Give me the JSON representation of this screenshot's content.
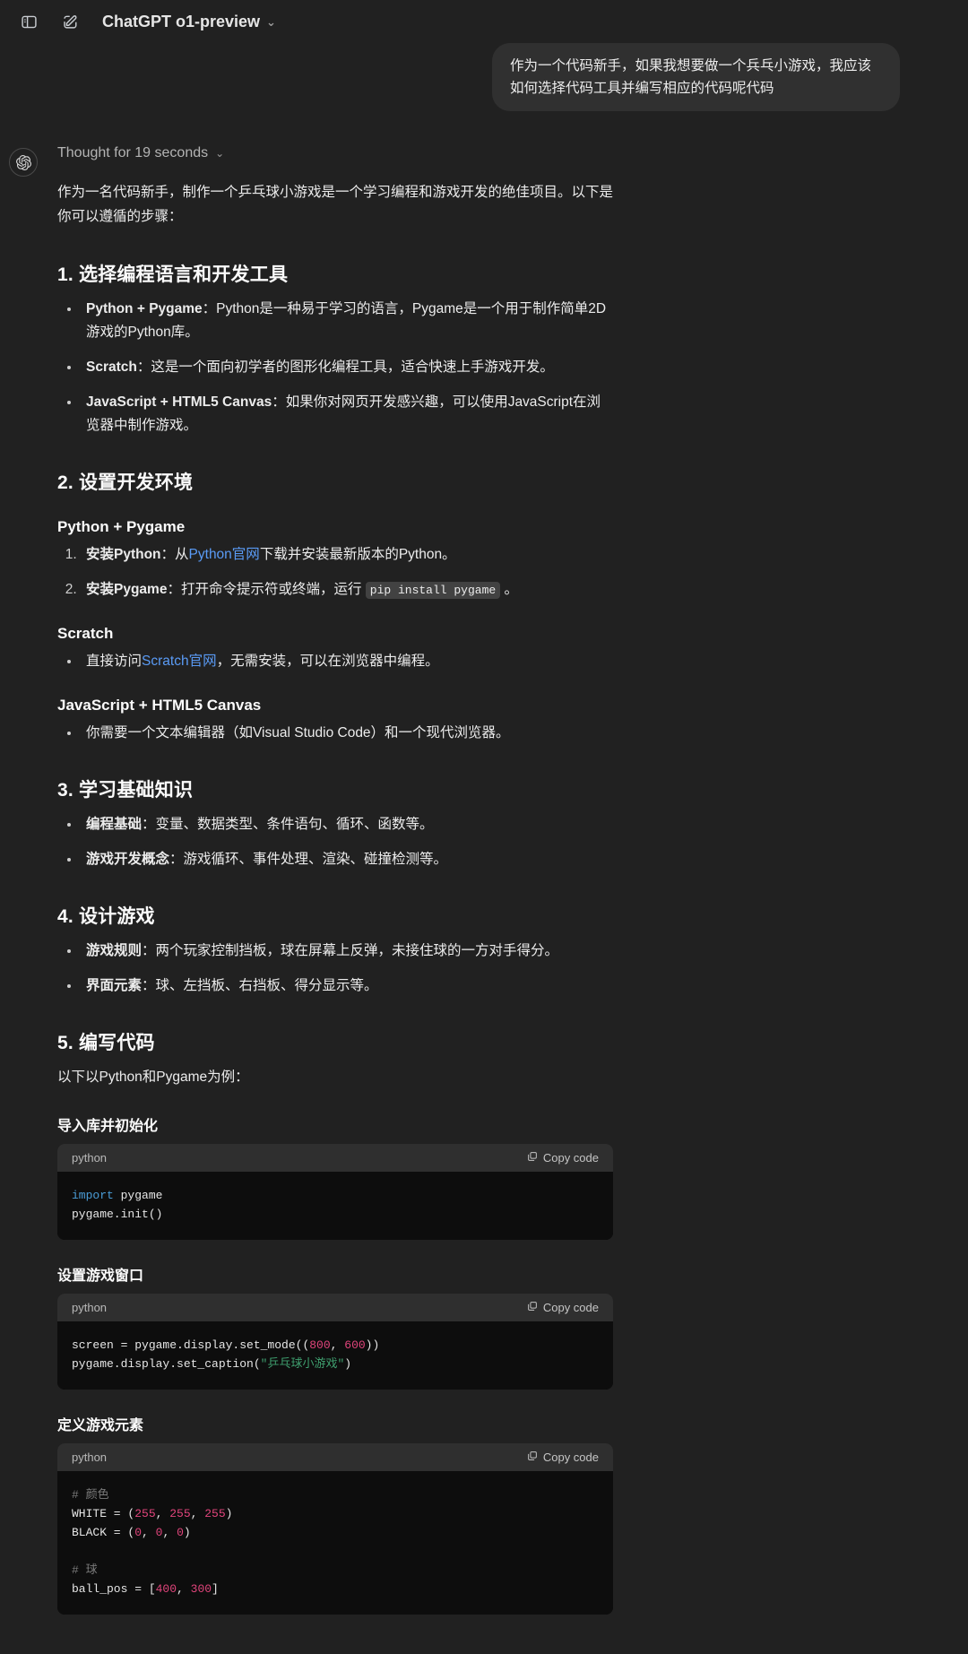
{
  "topbar": {
    "sidebar_toggle_icon": "sidebar-panel-icon",
    "new_chat_icon": "compose-pencil-icon",
    "model_label": "ChatGPT o1-preview",
    "chevron": "⌄"
  },
  "user_message": "作为一个代码新手，如果我想要做一个兵乓小游戏，我应该如何选择代码工具并编写相应的代码呢代码",
  "assistant": {
    "avatar_icon": "openai-logo-icon",
    "thought_label": "Thought for 19 seconds",
    "thought_chevron": "⌄",
    "intro": "作为一名代码新手，制作一个乒乓球小游戏是一个学习编程和游戏开发的绝佳项目。以下是你可以遵循的步骤：",
    "section1": {
      "heading": "1. 选择编程语言和开发工具",
      "items": [
        {
          "bold": "Python + Pygame",
          "rest": "：Python是一种易于学习的语言，Pygame是一个用于制作简单2D游戏的Python库。"
        },
        {
          "bold": "Scratch",
          "rest": "：这是一个面向初学者的图形化编程工具，适合快速上手游戏开发。"
        },
        {
          "bold": "JavaScript + HTML5 Canvas",
          "rest": "：如果你对网页开发感兴趣，可以使用JavaScript在浏览器中制作游戏。"
        }
      ]
    },
    "section2": {
      "heading": "2. 设置开发环境",
      "sub_python": "Python + Pygame",
      "py_step1": {
        "bold": "安装Python",
        "pre": "：从",
        "link": "Python官网",
        "post": "下载并安装最新版本的Python。"
      },
      "py_step2": {
        "bold": "安装Pygame",
        "pre": "：打开命令提示符或终端，运行 ",
        "code": "pip install pygame",
        "post": " 。"
      },
      "sub_scratch": "Scratch",
      "scratch_item": {
        "pre": "直接访问",
        "link": "Scratch官网",
        "post": "，无需安装，可以在浏览器中编程。"
      },
      "sub_js": "JavaScript + HTML5 Canvas",
      "js_item": "你需要一个文本编辑器（如Visual Studio Code）和一个现代浏览器。"
    },
    "section3": {
      "heading": "3. 学习基础知识",
      "items": [
        {
          "bold": "编程基础",
          "rest": "：变量、数据类型、条件语句、循环、函数等。"
        },
        {
          "bold": "游戏开发概念",
          "rest": "：游戏循环、事件处理、渲染、碰撞检测等。"
        }
      ]
    },
    "section4": {
      "heading": "4. 设计游戏",
      "items": [
        {
          "bold": "游戏规则",
          "rest": "：两个玩家控制挡板，球在屏幕上反弹，未接住球的一方对手得分。"
        },
        {
          "bold": "界面元素",
          "rest": "：球、左挡板、右挡板、得分显示等。"
        }
      ]
    },
    "section5": {
      "heading": "5. 编写代码",
      "lead": "以下以Python和Pygame为例：",
      "blocks": [
        {
          "caption": "导入库并初始化",
          "language": "python",
          "copy_label": "Copy code",
          "copy_icon": "copy-icon"
        },
        {
          "caption": "设置游戏窗口",
          "language": "python",
          "copy_label": "Copy code",
          "copy_icon": "copy-icon"
        },
        {
          "caption": "定义游戏元素",
          "language": "python",
          "copy_label": "Copy code",
          "copy_icon": "copy-icon"
        }
      ],
      "code1": {
        "l1_kw": "import",
        "l1_rest": " pygame",
        "l2": "pygame.init()"
      },
      "code2": {
        "l1_a": "screen = pygame.display.set_mode((",
        "l1_n1": "800",
        "l1_mid": ", ",
        "l1_n2": "600",
        "l1_b": "))",
        "l2_a": "pygame.display.set_caption(",
        "l2_str": "\"乒乓球小游戏\"",
        "l2_b": ")"
      },
      "code3": {
        "c1": "# 颜色",
        "w_a": "WHITE = (",
        "w_n1": "255",
        "w_s1": ", ",
        "w_n2": "255",
        "w_s2": ", ",
        "w_n3": "255",
        "w_b": ")",
        "k_a": "BLACK = (",
        "k_n1": "0",
        "k_s1": ", ",
        "k_n2": "0",
        "k_s2": ", ",
        "k_n3": "0",
        "k_b": ")",
        "c2": "# 球",
        "b_a": "ball_pos = [",
        "b_n1": "400",
        "b_s1": ", ",
        "b_n2": "300",
        "b_b": "]"
      }
    }
  },
  "colors": {
    "page_bg": "#212121",
    "user_bubble": "#303030",
    "code_bg": "#0d0d0d",
    "code_header_bg": "#2f2f2f",
    "link": "#5a9bf6",
    "keyword": "#4a9cd6",
    "number": "#e0447b",
    "string": "#3f9f6f",
    "comment": "#7a7a7a"
  }
}
